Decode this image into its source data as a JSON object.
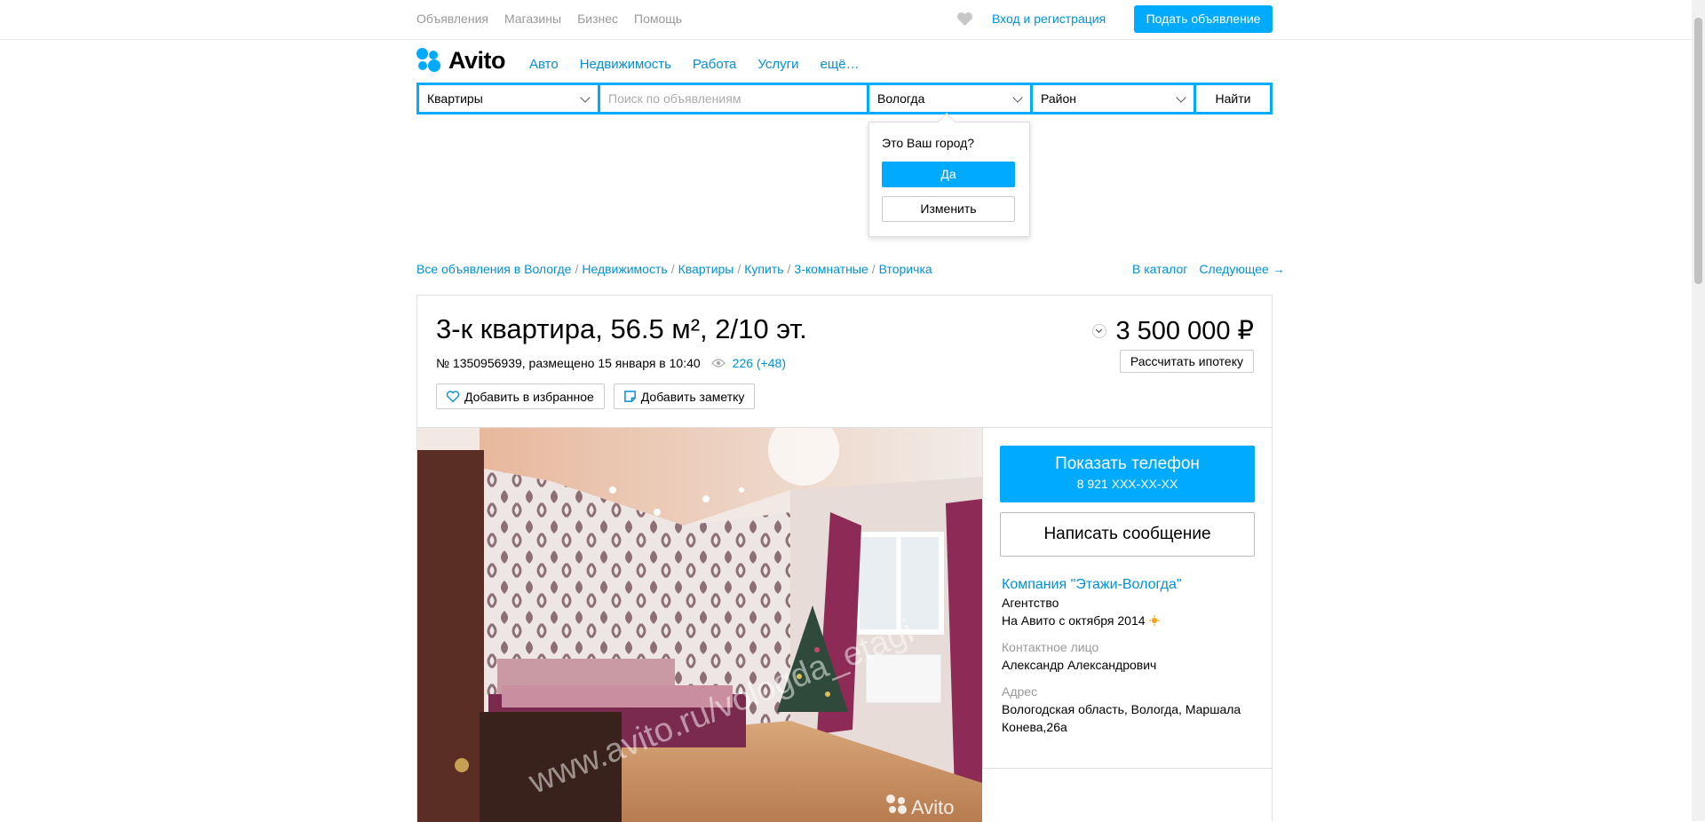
{
  "topbar": {
    "nav": [
      "Объявления",
      "Магазины",
      "Бизнес",
      "Помощь"
    ],
    "login": "Вход и регистрация",
    "post_ad": "Подать объявление"
  },
  "logo": {
    "text": "Avito"
  },
  "menu": [
    "Авто",
    "Недвижимость",
    "Работа",
    "Услуги",
    "ещё…"
  ],
  "search": {
    "category": "Квартиры",
    "placeholder": "Поиск по объявлениям",
    "city": "Вологда",
    "district": "Район",
    "find_label": "Найти"
  },
  "city_popup": {
    "question": "Это Ваш город?",
    "yes": "Да",
    "change": "Изменить"
  },
  "breadcrumbs": [
    "Все объявления в Вологде",
    "Недвижимость",
    "Квартиры",
    "Купить",
    "3-комнатные",
    "Вторичка"
  ],
  "catalog_links": {
    "catalog": "В каталог",
    "next": "Следующее →"
  },
  "listing": {
    "title": "3-к квартира, 56.5 м², 2/10 эт.",
    "meta": "№ 1350956939, размещено 15 января в 10:40",
    "views": "226 (+48)",
    "add_favorite": "Добавить в избранное",
    "add_note": "Добавить заметку",
    "price": "3 500 000 ₽",
    "mortgage": "Рассчитать ипотеку",
    "photo_watermark": "www.avito.ru/vologda_etagi",
    "photo_logo": "Avito"
  },
  "contact": {
    "show_phone": "Показать телефон",
    "phone_mask": "8 921 XXX-XX-XX",
    "write_message": "Написать сообщение",
    "company": "Компания \"Этажи-Вологда\"",
    "company_type": "Агентство",
    "since": "На Авито с октября 2014",
    "contact_label": "Контактное лицо",
    "contact_name": "Александр Александрович",
    "address_label": "Адрес",
    "address_line1": "Вологодская область, Вологда, Маршала",
    "address_line2": "Конева,26а"
  },
  "colors": {
    "accent": "#00aaff",
    "link": "#0091d9"
  }
}
